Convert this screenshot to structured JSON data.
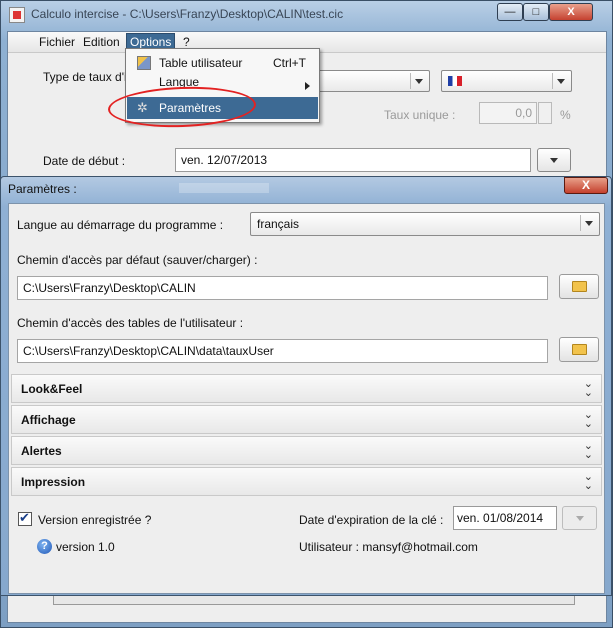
{
  "window": {
    "title": "Calculo intercise - C:\\Users\\Franzy\\Desktop\\CALIN\\test.cic",
    "min": "—",
    "max": "□",
    "close": "X"
  },
  "menubar": {
    "items": [
      "Fichier",
      "Edition",
      "Options",
      "?"
    ]
  },
  "main_form": {
    "type_label": "Type de taux d'i",
    "taux_label": "Taux unique :",
    "taux_value": "0,0",
    "taux_unit": "%",
    "date_label": "Date de début :",
    "date_value": "ven. 12/07/2013"
  },
  "options_menu": {
    "items": [
      {
        "label": "Table utilisateur",
        "shortcut": "Ctrl+T",
        "icon": "table-edit-icon"
      },
      {
        "label": "Langue",
        "icon": "submenu-arrow-icon"
      },
      {
        "label": "Paramètres",
        "icon": "gear-icon",
        "highlighted": true
      }
    ]
  },
  "dialog": {
    "title": "Paramètres :",
    "close": "X",
    "langue_label": "Langue au démarrage du programme :",
    "langue_value": "français",
    "chemin1_label": "Chemin d'accès par défaut (sauver/charger) :",
    "chemin1_value": "C:\\Users\\Franzy\\Desktop\\CALIN",
    "chemin2_label": "Chemin d'accès des tables de l'utilisateur :",
    "chemin2_value": "C:\\Users\\Franzy\\Desktop\\CALIN\\data\\tauxUser",
    "sections": [
      "Look&Feel",
      "Affichage",
      "Alertes",
      "Impression"
    ],
    "version_registered_label": "Version enregistrée ?",
    "version_registered_checked": true,
    "version_text": "version 1.0",
    "expiry_label": "Date d'expiration de la clé :",
    "expiry_value": "ven. 01/08/2014",
    "user_label": "Utilisateur :  mansyf@hotmail.com"
  },
  "colors": {
    "menu_highlight": "#3d6a94",
    "annotation": "#e32222",
    "titlebar": "#8fb0d4"
  }
}
